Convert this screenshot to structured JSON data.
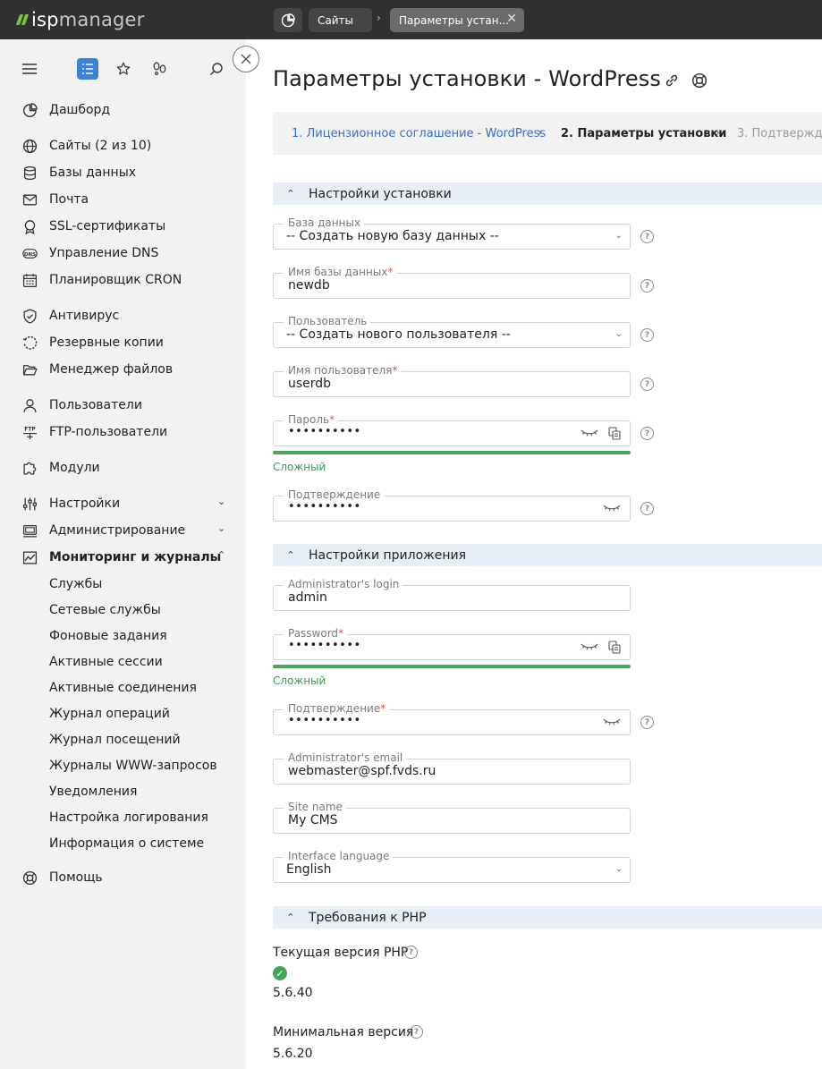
{
  "brand": {
    "logo_prefix": "isp",
    "logo_suffix": "manager",
    "accent": "#7ec243"
  },
  "topbar": {
    "tabs": [
      {
        "label": "Сайты"
      },
      {
        "label": "Параметры устан..."
      }
    ]
  },
  "sidebar": {
    "items": [
      {
        "label": "Дашборд",
        "icon": "dashboard-icon"
      },
      {
        "label": "Сайты (2 из 10)",
        "icon": "globe-icon"
      },
      {
        "label": "Базы данных",
        "icon": "database-icon"
      },
      {
        "label": "Почта",
        "icon": "mail-icon"
      },
      {
        "label": "SSL-сертификаты",
        "icon": "certificate-icon"
      },
      {
        "label": "Управление DNS",
        "icon": "dns-icon"
      },
      {
        "label": "Планировщик CRON",
        "icon": "calendar-icon"
      },
      {
        "label": "Антивирус",
        "icon": "shield-icon"
      },
      {
        "label": "Резервные копии",
        "icon": "backup-icon"
      },
      {
        "label": "Менеджер файлов",
        "icon": "folder-icon"
      },
      {
        "label": "Пользователи",
        "icon": "user-icon"
      },
      {
        "label": "FTP-пользователи",
        "icon": "ftp-icon"
      },
      {
        "label": "Модули",
        "icon": "puzzle-icon"
      },
      {
        "label": "Настройки",
        "icon": "sliders-icon"
      },
      {
        "label": "Администрирование",
        "icon": "monitor-icon"
      },
      {
        "label": "Мониторинг и журналы",
        "icon": "chart-icon"
      }
    ],
    "monitoring_subitems": [
      "Службы",
      "Сетевые службы",
      "Фоновые задания",
      "Активные сессии",
      "Активные соединения",
      "Журнал операций",
      "Журнал посещений",
      "Журналы WWW-запросов",
      "Уведомления",
      "Настройка логирования",
      "Информация о системе"
    ],
    "help": {
      "label": "Помощь",
      "icon": "lifebuoy-icon"
    }
  },
  "page": {
    "title": "Параметры установки - WordPress",
    "steps": [
      "1. Лицензионное соглашение - WordPress",
      "2. Параметры установки",
      "3. Подтвержде"
    ]
  },
  "sections": {
    "install": "Настройки установки",
    "app": "Настройки приложения",
    "php": "Требования к PHP"
  },
  "install_form": {
    "db": {
      "label": "База данных",
      "value": "-- Создать новую базу данных --"
    },
    "db_name": {
      "label": "Имя базы данных",
      "value": "newdb"
    },
    "user": {
      "label": "Пользователь",
      "value": "-- Создать нового пользователя --"
    },
    "user_name": {
      "label": "Имя пользователя",
      "value": "userdb"
    },
    "password": {
      "label": "Пароль",
      "value": "••••••••••"
    },
    "password_strength": "Сложный",
    "confirm": {
      "label": "Подтверждение",
      "value": "••••••••••"
    }
  },
  "app_form": {
    "login": {
      "label": "Administrator's login",
      "value": "admin"
    },
    "password": {
      "label": "Password",
      "value": "••••••••••"
    },
    "password_strength": "Сложный",
    "confirm": {
      "label": "Подтверждение",
      "value": "••••••••••"
    },
    "email": {
      "label": "Administrator's email",
      "value": "webmaster@spf.fvds.ru"
    },
    "site_name": {
      "label": "Site name",
      "value": "My CMS"
    },
    "language": {
      "label": "Interface language",
      "value": "English"
    }
  },
  "php": {
    "current_label": "Текущая версия PHP",
    "current_value": "5.6.40",
    "min_label": "Минимальная версия",
    "min_value": "5.6.20"
  }
}
